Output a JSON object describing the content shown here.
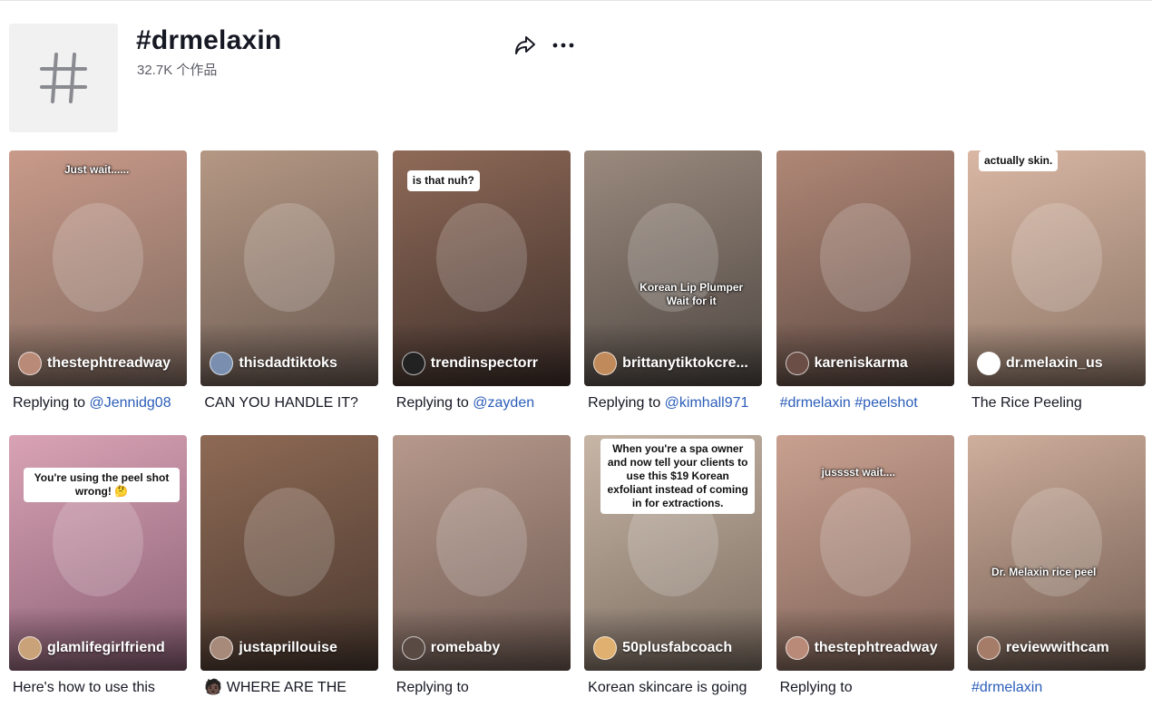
{
  "header": {
    "title": "#drmelaxin",
    "count": "32.7K 个作品",
    "share_icon": "share-arrow-icon",
    "more_icon": "more-dots-icon"
  },
  "videos": [
    {
      "author": "thestephtreadway",
      "overlay": {
        "text": "Just wait......",
        "style": "clear"
      },
      "caption": {
        "text": "Replying to",
        "link": "@Jennidg08",
        "rest": ""
      },
      "colors": {
        "bg1": "#c99a8a",
        "bg2": "#7f6a5f",
        "avatar": "#b98a78"
      }
    },
    {
      "author": "thisdadtiktoks",
      "overlay": {
        "text": "",
        "style": "none"
      },
      "caption": {
        "text": "CAN YOU HANDLE IT?",
        "link": "",
        "rest": ""
      },
      "colors": {
        "bg1": "#b59884",
        "bg2": "#6a5a52",
        "avatar": "#7a8fb0"
      }
    },
    {
      "author": "trendinspectorr",
      "overlay": {
        "text": "is that nuh?",
        "style": "white"
      },
      "caption": {
        "text": "Replying to",
        "link": "@zayden",
        "rest": ""
      },
      "colors": {
        "bg1": "#8f6a58",
        "bg2": "#3e2f2a",
        "avatar": "#222222"
      }
    },
    {
      "author": "brittanytiktokcre...",
      "overlay": {
        "text": "Korean Lip Plumper Wait for it",
        "style": "clear"
      },
      "caption": {
        "text": "Replying to",
        "link": "@kimhall971",
        "rest": ""
      },
      "colors": {
        "bg1": "#9b8a7e",
        "bg2": "#4e4742",
        "avatar": "#c08a5a"
      }
    },
    {
      "author": "kareniskarma",
      "overlay": {
        "text": "",
        "style": "none"
      },
      "caption": {
        "text": "",
        "link": "#drmelaxin #peelshot",
        "rest": ""
      },
      "colors": {
        "bg1": "#b08776",
        "bg2": "#5c4942",
        "avatar": "#6b4e45"
      }
    },
    {
      "author": "dr.melaxin_us",
      "overlay": {
        "text": "actually skin.",
        "style": "white"
      },
      "caption": {
        "text": "The Rice Peeling",
        "link": "",
        "rest": ""
      },
      "colors": {
        "bg1": "#d9b7a4",
        "bg2": "#8c7566",
        "avatar": "#ffffff"
      }
    },
    {
      "author": "glamlifegirlfriend",
      "overlay": {
        "text": "You're using the peel shot wrong! 🤔",
        "style": "white"
      },
      "caption": {
        "text": "Here's how to use this",
        "link": "",
        "rest": ""
      },
      "colors": {
        "bg1": "#d9a3b5",
        "bg2": "#8a5f73",
        "avatar": "#c9a27a"
      }
    },
    {
      "author": "justaprillouise",
      "overlay": {
        "text": "",
        "style": "none"
      },
      "caption": {
        "text": "🧑🏿 WHERE ARE THE",
        "link": "",
        "rest": ""
      },
      "colors": {
        "bg1": "#8e6a55",
        "bg2": "#4a382f",
        "avatar": "#a88a7a"
      }
    },
    {
      "author": "romebaby",
      "overlay": {
        "text": "",
        "style": "none"
      },
      "caption": {
        "text": "Replying to",
        "link": "",
        "rest": ""
      },
      "colors": {
        "bg1": "#b7998c",
        "bg2": "#6e5a52",
        "avatar": "#5a4a44"
      }
    },
    {
      "author": "50plusfabcoach",
      "overlay": {
        "text": "When you're a spa owner and now tell your clients to use this $19 Korean exfoliant instead of coming in for extractions.",
        "style": "white"
      },
      "caption": {
        "text": "Korean skincare is going",
        "link": "",
        "rest": ""
      },
      "colors": {
        "bg1": "#c7b6a6",
        "bg2": "#7b6c60",
        "avatar": "#e0b070"
      }
    },
    {
      "author": "thestephtreadway",
      "overlay": {
        "text": "jusssst wait....",
        "style": "clear"
      },
      "caption": {
        "text": "Replying to",
        "link": "",
        "rest": ""
      },
      "colors": {
        "bg1": "#c9a090",
        "bg2": "#7d6257",
        "avatar": "#b98a78"
      }
    },
    {
      "author": "reviewwithcam",
      "overlay": {
        "text": "Dr. Melaxin rice peel",
        "style": "clear"
      },
      "caption": {
        "text": "",
        "link": "#drmelaxin",
        "rest": ""
      },
      "colors": {
        "bg1": "#cfae9c",
        "bg2": "#6f5b50",
        "avatar": "#a57c68"
      }
    }
  ]
}
